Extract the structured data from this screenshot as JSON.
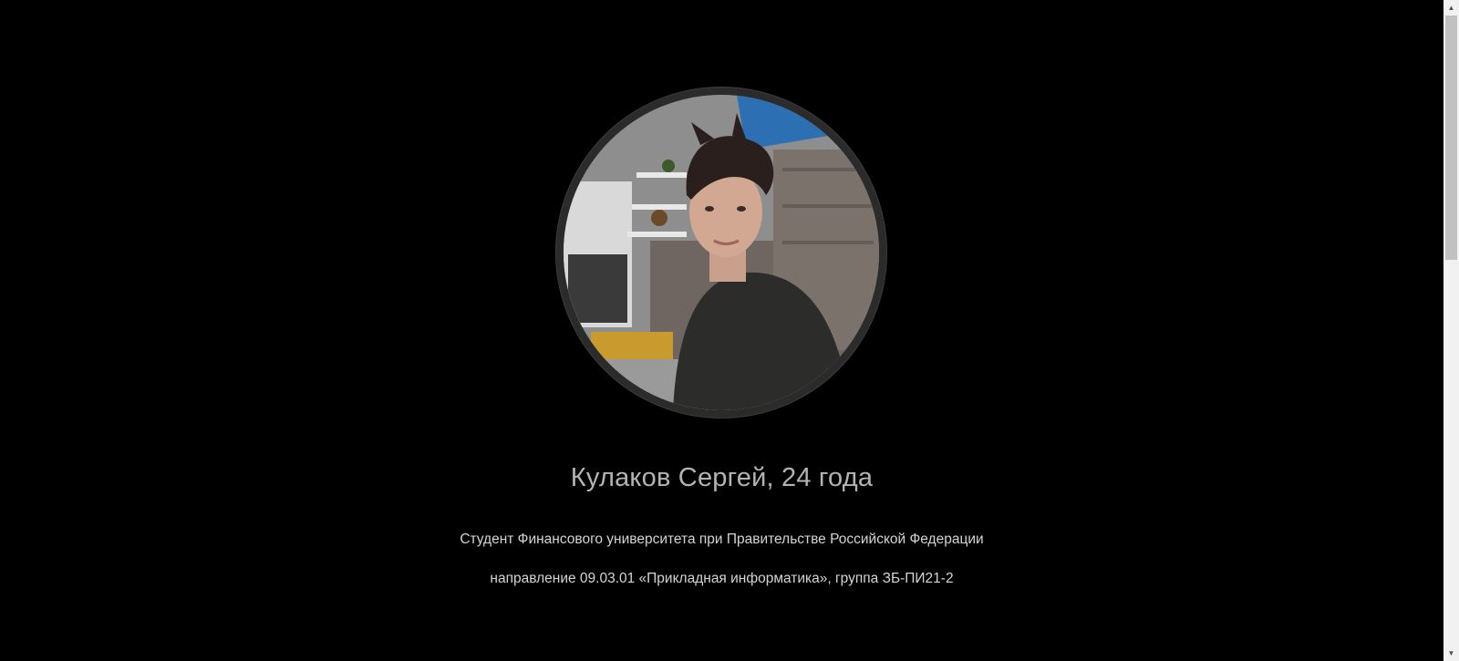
{
  "profile": {
    "photo_alt": "Кулаков Сергей",
    "name_age": "Кулаков Сергей, 24 года",
    "line1": "Студент Финансового университета при Правительстве Российской Федерации",
    "line2": "направление 09.03.01 «Прикладная информатика», группа ЗБ-ПИ21-2"
  },
  "scrollbar": {
    "up_icon": "chevron-up-icon",
    "down_icon": "chevron-down-icon",
    "scroll_fraction": 0.0
  },
  "colors": {
    "background": "#000000",
    "heading": "#b3b3b3",
    "text": "#d4d4d4",
    "ring": "#2b2b2b"
  }
}
